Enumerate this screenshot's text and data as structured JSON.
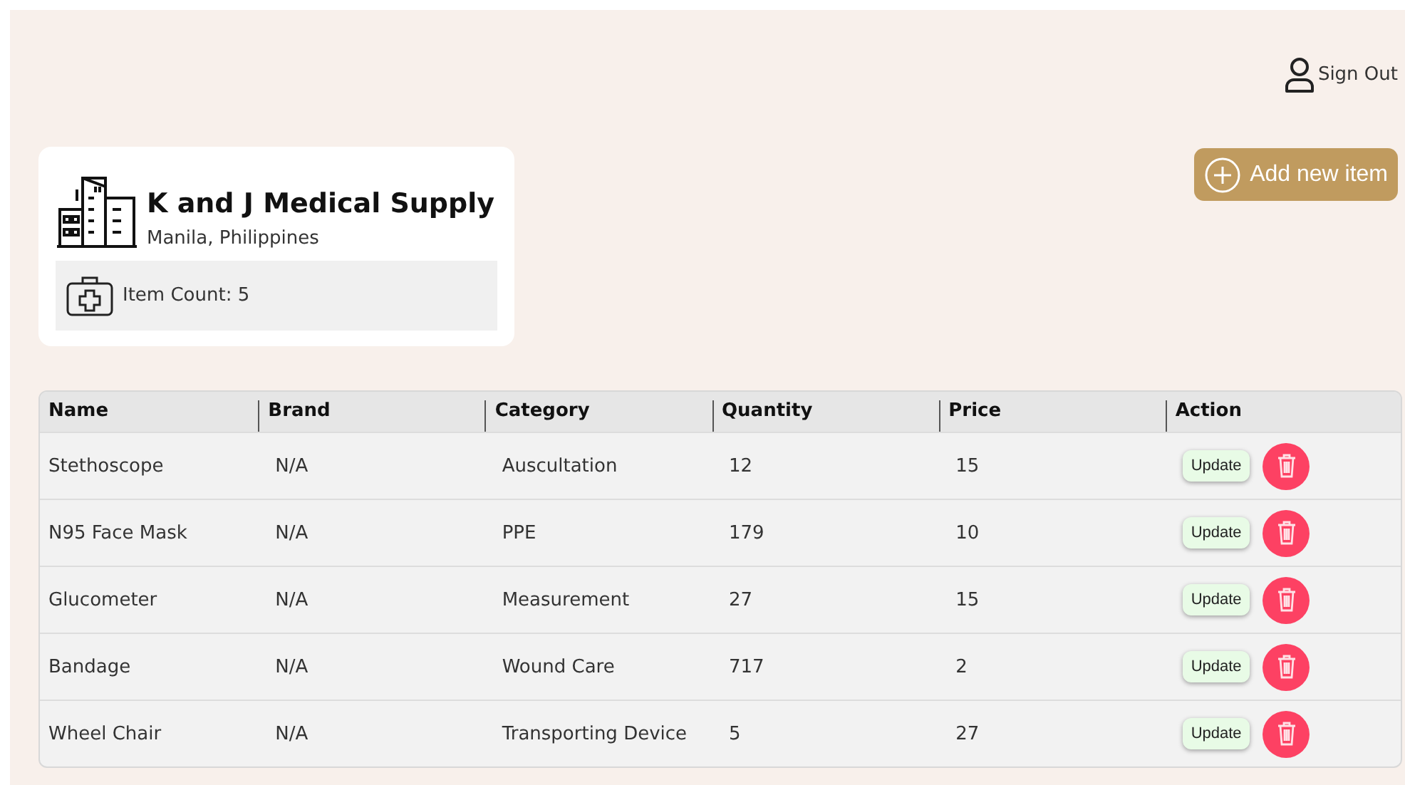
{
  "header": {
    "sign_out": "Sign Out"
  },
  "store": {
    "name": "K and J Medical Supply",
    "location": "Manila, Philippines",
    "item_count": "Item Count: 5"
  },
  "add_button": "Add new item",
  "table": {
    "columns": [
      "Name",
      "Brand",
      "Category",
      "Quantity",
      "Price",
      "Action"
    ],
    "rows": [
      {
        "cells": [
          "Stethoscope",
          "N/A",
          "Auscultation",
          "12",
          "15"
        ],
        "update": "Update"
      },
      {
        "cells": [
          "N95 Face Mask",
          "N/A",
          "PPE",
          "179",
          "10"
        ],
        "update": "Update"
      },
      {
        "cells": [
          "Glucometer",
          "N/A",
          "Measurement",
          "27",
          "15"
        ],
        "update": "Update"
      },
      {
        "cells": [
          "Bandage",
          "N/A",
          "Wound Care",
          "717",
          "2"
        ],
        "update": "Update"
      },
      {
        "cells": [
          "Wheel Chair",
          "N/A",
          "Transporting Device",
          "5",
          "27"
        ],
        "update": "Update"
      }
    ]
  }
}
